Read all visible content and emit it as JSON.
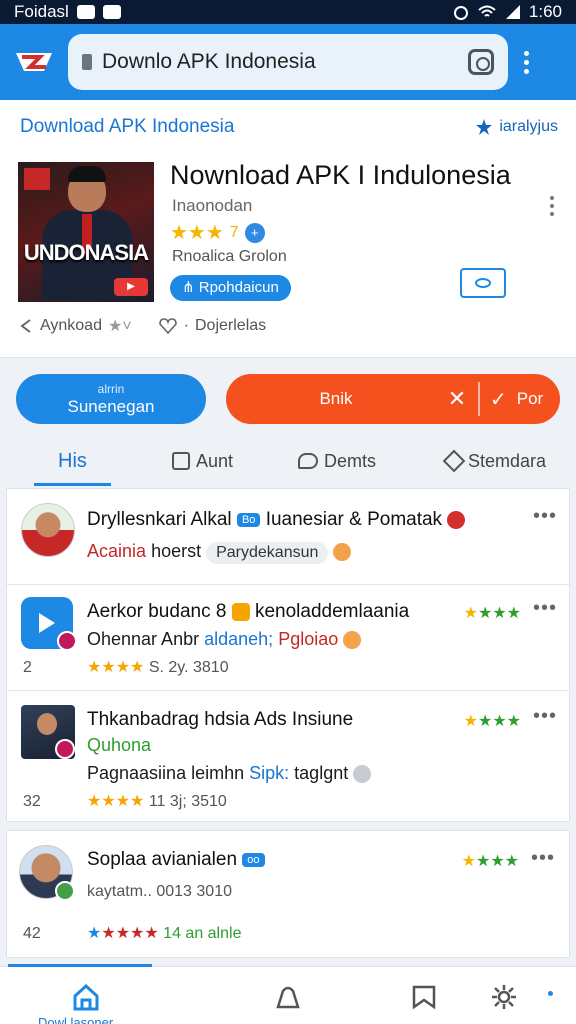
{
  "status_bar": {
    "left_text": "Foidasl",
    "time": "1:60"
  },
  "browser": {
    "url_text": "Downlo APK Indonesia"
  },
  "page": {
    "breadcrumb": "Download APK Indonesia",
    "header_right": "iaralyjus"
  },
  "app": {
    "thumb_word": "UNDONASIA",
    "title": "Nownload APK I Indulonesia",
    "subtitle": "Inaonodan",
    "rating_stars": "★★★",
    "rating_value": "7",
    "developer": "Rnoalica Grolon",
    "pill_label": "Rpohdaicun",
    "meta_download": "Aynkoad",
    "meta_dojer": "Dojerlelas"
  },
  "actions": {
    "blue_top": "alrrin",
    "blue_main": "Sunenegan",
    "orange_label": "Bnik",
    "orange_right": "Por"
  },
  "tabs": [
    {
      "label": "His"
    },
    {
      "label": "Aunt"
    },
    {
      "label": "Demts"
    },
    {
      "label": "Stemdara"
    }
  ],
  "items": [
    {
      "title_a": "Dryllesnkari Alkal",
      "tag": "Bo",
      "title_b": "Iuanesiar & Pomatak",
      "line2_red": "Acainia",
      "line2_rest": "hoerst",
      "chip": "Parydekansun"
    },
    {
      "title": "Aerkor budanc 8",
      "title_b": "kenoladdemlaania",
      "greenstars": "★★★",
      "l2_a": "Ohennar Anbr",
      "l2_blue": "aldaneh;",
      "l2_red": "Pgloiao",
      "num": "2",
      "stars": "★★★★",
      "date": "S. 2y. 3810"
    },
    {
      "title": "Thkanbadrag hdsia Ads Insiune",
      "greenstars": "★★★",
      "l2_green": "Quhona",
      "l3_a": "Pagnaasiina leimhn",
      "l3_blue": "Sipk:",
      "l3_b": "taglgnt",
      "num": "32",
      "stars": "★★★★",
      "date": "11 3j; 3510"
    },
    {
      "title": "Soplaa avianialen",
      "tag": "oo",
      "greenstars": "★★★",
      "sub": "kaytatm.. 0013 3010",
      "num": "42",
      "stars": "★★★★",
      "date": "14 an alnle"
    }
  ],
  "bottom_nav": {
    "active_label": "Dowl lasoner"
  },
  "colors": {
    "primary": "#1e88e5",
    "accent_orange": "#f4511e",
    "star": "#f5a400"
  },
  "icons": [
    "wifi-icon",
    "lock-icon",
    "camera-icon",
    "menu-dots-icon",
    "home-icon",
    "bookmark-icon",
    "settings-icon"
  ]
}
